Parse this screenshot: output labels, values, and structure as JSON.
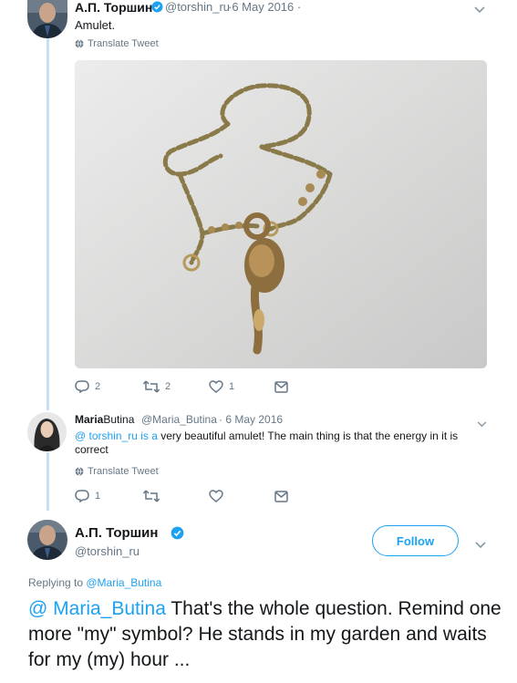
{
  "tweet1": {
    "display_name": "А.П. Торшин",
    "handle": "@torshin_ru",
    "date": "·6 May 2016 ·",
    "text": "Amulet.",
    "translate": "Translate Tweet",
    "replies": "2",
    "retweets": "2",
    "likes": "1"
  },
  "tweet2": {
    "display_name_first": "Maria",
    "display_name_rest": "Butina",
    "handle": "@Maria_Butina",
    "date": "· 6 May 2016",
    "mention": "@ torshin_ru is a",
    "text_rest": " very beautiful amulet! The main thing is that the energy in it is",
    "text_line2": "correct",
    "translate": "Translate Tweet",
    "replies": "1"
  },
  "tweet3": {
    "display_name": "А.П. Торшин",
    "handle": "@torshin_ru",
    "follow_label": "Follow",
    "replying_prefix": "Replying to ",
    "replying_to": "@Maria_Butina",
    "mention": "@ Maria_Butina",
    "text": " That's the whole question. Remind one more \"my\" symbol? He stands in my garden and waits for my (my) hour ..."
  },
  "colors": {
    "accent": "#1da1f2",
    "thread_line": "#c4dff6",
    "muted": "#657786"
  },
  "icons": [
    "reply-icon",
    "retweet-icon",
    "like-icon",
    "message-icon",
    "globe-icon",
    "verified-icon",
    "chevron-down-icon"
  ]
}
